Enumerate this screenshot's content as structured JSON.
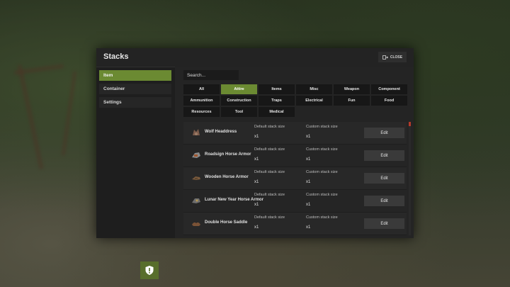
{
  "window": {
    "title": "Stacks",
    "close_label": "CLOSE"
  },
  "sidebar": {
    "items": [
      {
        "label": "Item",
        "active": true
      },
      {
        "label": "Container",
        "active": false
      },
      {
        "label": "Settings",
        "active": false
      }
    ]
  },
  "search": {
    "placeholder": "Search..."
  },
  "categories": [
    {
      "label": "All",
      "active": false
    },
    {
      "label": "Attire",
      "active": true
    },
    {
      "label": "Items",
      "active": false
    },
    {
      "label": "Misc",
      "active": false
    },
    {
      "label": "Weapon",
      "active": false
    },
    {
      "label": "Component",
      "active": false
    },
    {
      "label": "Ammunition",
      "active": false
    },
    {
      "label": "Construction",
      "active": false
    },
    {
      "label": "Traps",
      "active": false
    },
    {
      "label": "Electrical",
      "active": false
    },
    {
      "label": "Fun",
      "active": false
    },
    {
      "label": "Food",
      "active": false
    },
    {
      "label": "Resources",
      "active": false
    },
    {
      "label": "Tool",
      "active": false
    },
    {
      "label": "Medical",
      "active": false
    }
  ],
  "columns": {
    "default_label": "Default stack size",
    "custom_label": "Custom stack size"
  },
  "items": [
    {
      "name": "Wolf Headdress",
      "default": "x1",
      "custom": "x1",
      "edit_label": "Edit"
    },
    {
      "name": "Roadsign Horse Armor",
      "default": "x1",
      "custom": "x1",
      "edit_label": "Edit"
    },
    {
      "name": "Wooden Horse Armor",
      "default": "x1",
      "custom": "x1",
      "edit_label": "Edit"
    },
    {
      "name": "Lunar New Year Horse Armor",
      "default": "x1",
      "custom": "x1",
      "edit_label": "Edit"
    },
    {
      "name": "Double Horse Saddle",
      "default": "x1",
      "custom": "x1",
      "edit_label": "Edit"
    }
  ],
  "colors": {
    "accent": "#6b8a32",
    "scroll_thumb": "#b23a2a",
    "shield": "#586e2c"
  },
  "icons": {
    "close": "exit-door-icon",
    "shield": "shield-alert-icon"
  }
}
